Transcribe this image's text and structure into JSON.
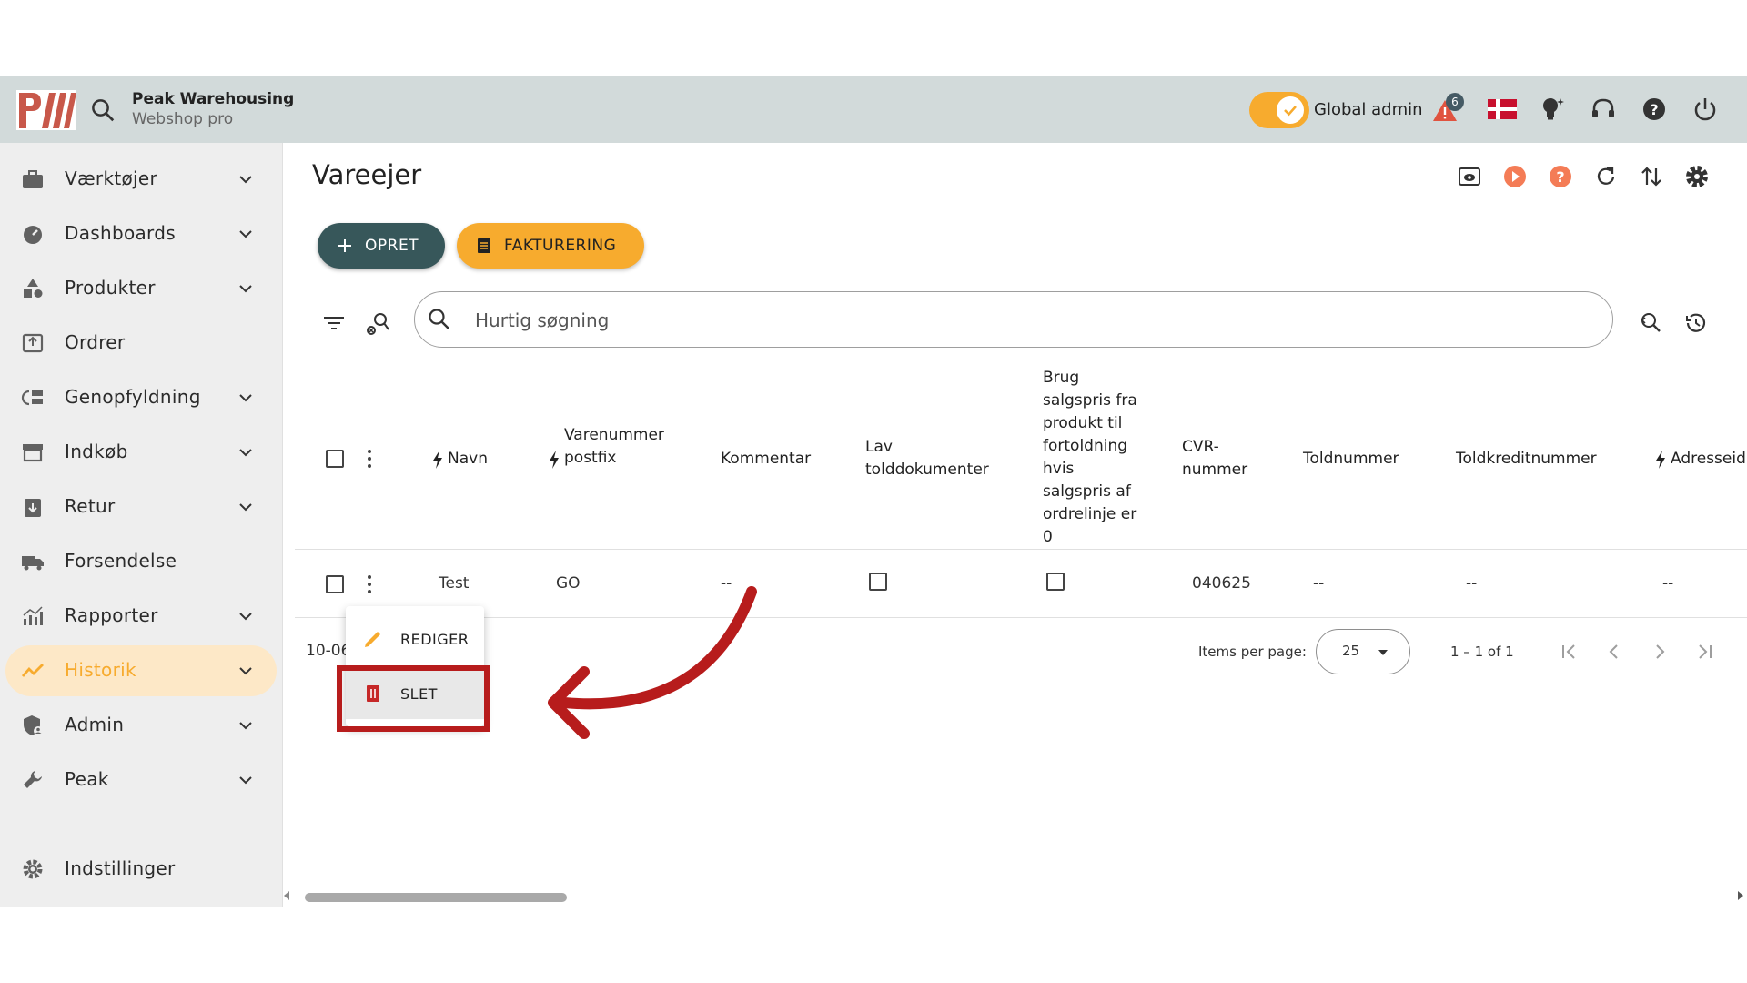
{
  "topbar": {
    "brand_title": "Peak Warehousing",
    "brand_sub": "Webshop pro",
    "toggle_label": "Global admin",
    "notification_count": "6",
    "accent_color": "#f7ab2e"
  },
  "sidebar": {
    "items": [
      {
        "label": "Værktøjer"
      },
      {
        "label": "Dashboards"
      },
      {
        "label": "Produkter"
      },
      {
        "label": "Ordrer"
      },
      {
        "label": "Genopfyldning"
      },
      {
        "label": "Indkøb"
      },
      {
        "label": "Retur"
      },
      {
        "label": "Forsendelse"
      },
      {
        "label": "Rapporter"
      },
      {
        "label": "Historik"
      },
      {
        "label": "Admin"
      },
      {
        "label": "Peak"
      }
    ],
    "settings_label": "Indstillinger"
  },
  "main": {
    "title": "Vareejer",
    "create_label": "OPRET",
    "invoice_label": "FAKTURERING",
    "search_placeholder": "Hurtig søgning"
  },
  "table": {
    "headers": {
      "navn": "Navn",
      "varenummer_1": "Varenummer",
      "varenummer_2": "postfix",
      "kommentar": "Kommentar",
      "lav_1": "Lav",
      "lav_2": "tolddokumenter",
      "brug_1": "Brug",
      "brug_2": "salgspris fra",
      "brug_3": "produkt til",
      "brug_4": "fortoldning",
      "brug_5": "hvis",
      "brug_6": "salgspris af",
      "brug_7": "ordrelinje er",
      "brug_8": "0",
      "cvr_1": "CVR-",
      "cvr_2": "nummer",
      "toldnummer": "Toldnummer",
      "toldkredit": "Toldkreditnummer",
      "adresse": "Adresseid"
    },
    "row": {
      "navn": "Test",
      "varenummer": "GO",
      "kommentar": "--",
      "cvr": "040625",
      "toldnummer": "--",
      "toldkredit": "--",
      "adresse": "--"
    },
    "partial_text": "10-06"
  },
  "pagination": {
    "items_per_page_label": "Items per page:",
    "items_per_page_value": "25",
    "range": "1 – 1 of 1"
  },
  "context_menu": {
    "edit_label": "REDIGER",
    "delete_label": "SLET"
  },
  "icons": [
    "search-icon",
    "warning-bell-icon",
    "danish-flag-icon",
    "lightbulb-icon",
    "headset-icon",
    "help-icon",
    "power-icon",
    "preview-icon",
    "play-icon",
    "question-icon",
    "refresh-icon",
    "sort-icon",
    "gear-icon",
    "filter-icon",
    "user-search-icon",
    "zoom-reset-icon",
    "history-icon"
  ]
}
